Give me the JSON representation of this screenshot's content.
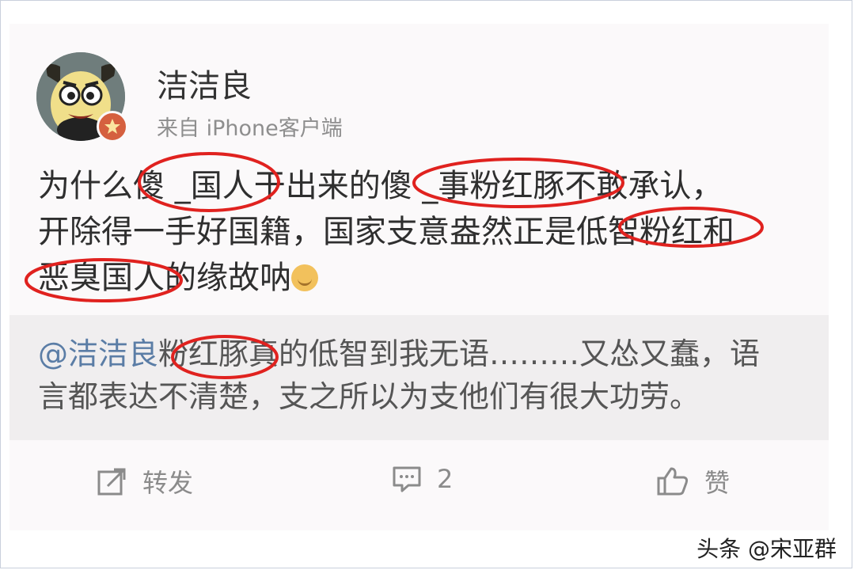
{
  "post": {
    "username": "洁洁良",
    "source": "来自 iPhone客户端",
    "lines": [
      "为什么傻 _国人干出来的傻 _事粉红豚不敢承认，",
      "开除得一手好国籍，国家支意盎然正是低智粉红和",
      "恶臭国人的缘故呐"
    ],
    "emoji_icon": "smile-emoji-icon"
  },
  "repost": {
    "mention": "@洁洁良",
    "line1_rest": "粉红豚真的低智到我无语………又怂又蠢，语",
    "line2": "言都表达不清楚，支之所以为支他们有很大功劳。"
  },
  "actions": {
    "repost_label": "转发",
    "comment_count": "2",
    "like_label": "赞"
  },
  "watermark": "头条 @宋亚群",
  "colors": {
    "annotation_red": "#e0221f",
    "mention_blue": "#5b7da6"
  }
}
